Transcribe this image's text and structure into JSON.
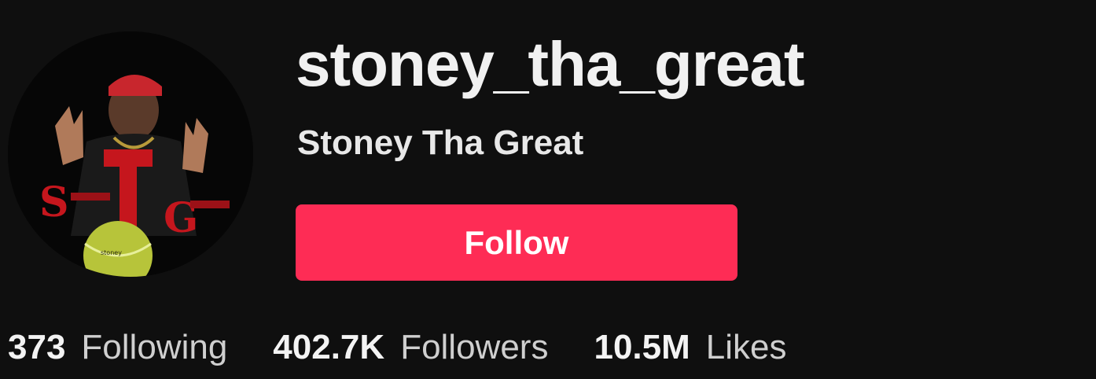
{
  "profile": {
    "username": "stoney_tha_great",
    "display_name": "Stoney Tha Great",
    "avatar": "profile-photo with red graffiti logo and tennis ball"
  },
  "actions": {
    "follow_label": "Follow"
  },
  "stats": {
    "following": {
      "count": "373",
      "label": "Following"
    },
    "followers": {
      "count": "402.7K",
      "label": "Followers"
    },
    "likes": {
      "count": "10.5M",
      "label": "Likes"
    }
  },
  "colors": {
    "background": "#0f0f0f",
    "follow_button": "#fe2c55",
    "text_primary": "#f1f1f1",
    "text_secondary": "#cfcfcf"
  }
}
